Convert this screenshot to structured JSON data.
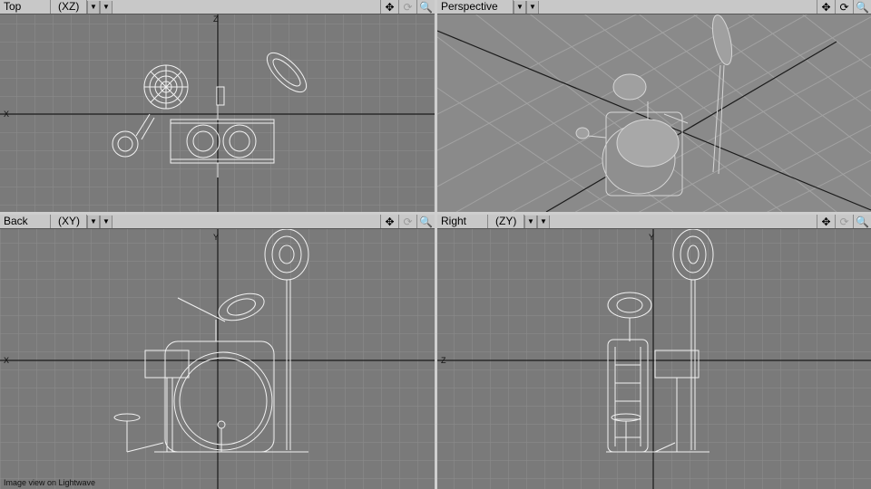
{
  "viewports": {
    "top": {
      "name": "Top",
      "axis": "(XZ)",
      "axis_marker_v": "Z",
      "axis_marker_h": "X"
    },
    "perspective": {
      "name": "Perspective"
    },
    "back": {
      "name": "Back",
      "axis": "(XY)",
      "axis_marker_v": "Y",
      "axis_marker_h": "X"
    },
    "right": {
      "name": "Right",
      "axis": "(ZY)",
      "axis_marker_v": "Y",
      "axis_marker_h": "Z"
    }
  },
  "icons": {
    "move": "✥",
    "rotate": "⟳",
    "zoom": "🔍",
    "dropdown": "▼"
  },
  "caption": "Image view on Lightwave",
  "colors": {
    "viewport_bg": "#7a7a7a",
    "grid": "#8c8c8c",
    "axis": "#1a1a1a",
    "wireframe": "#f2f2f2",
    "header": "#c8c8c8"
  }
}
